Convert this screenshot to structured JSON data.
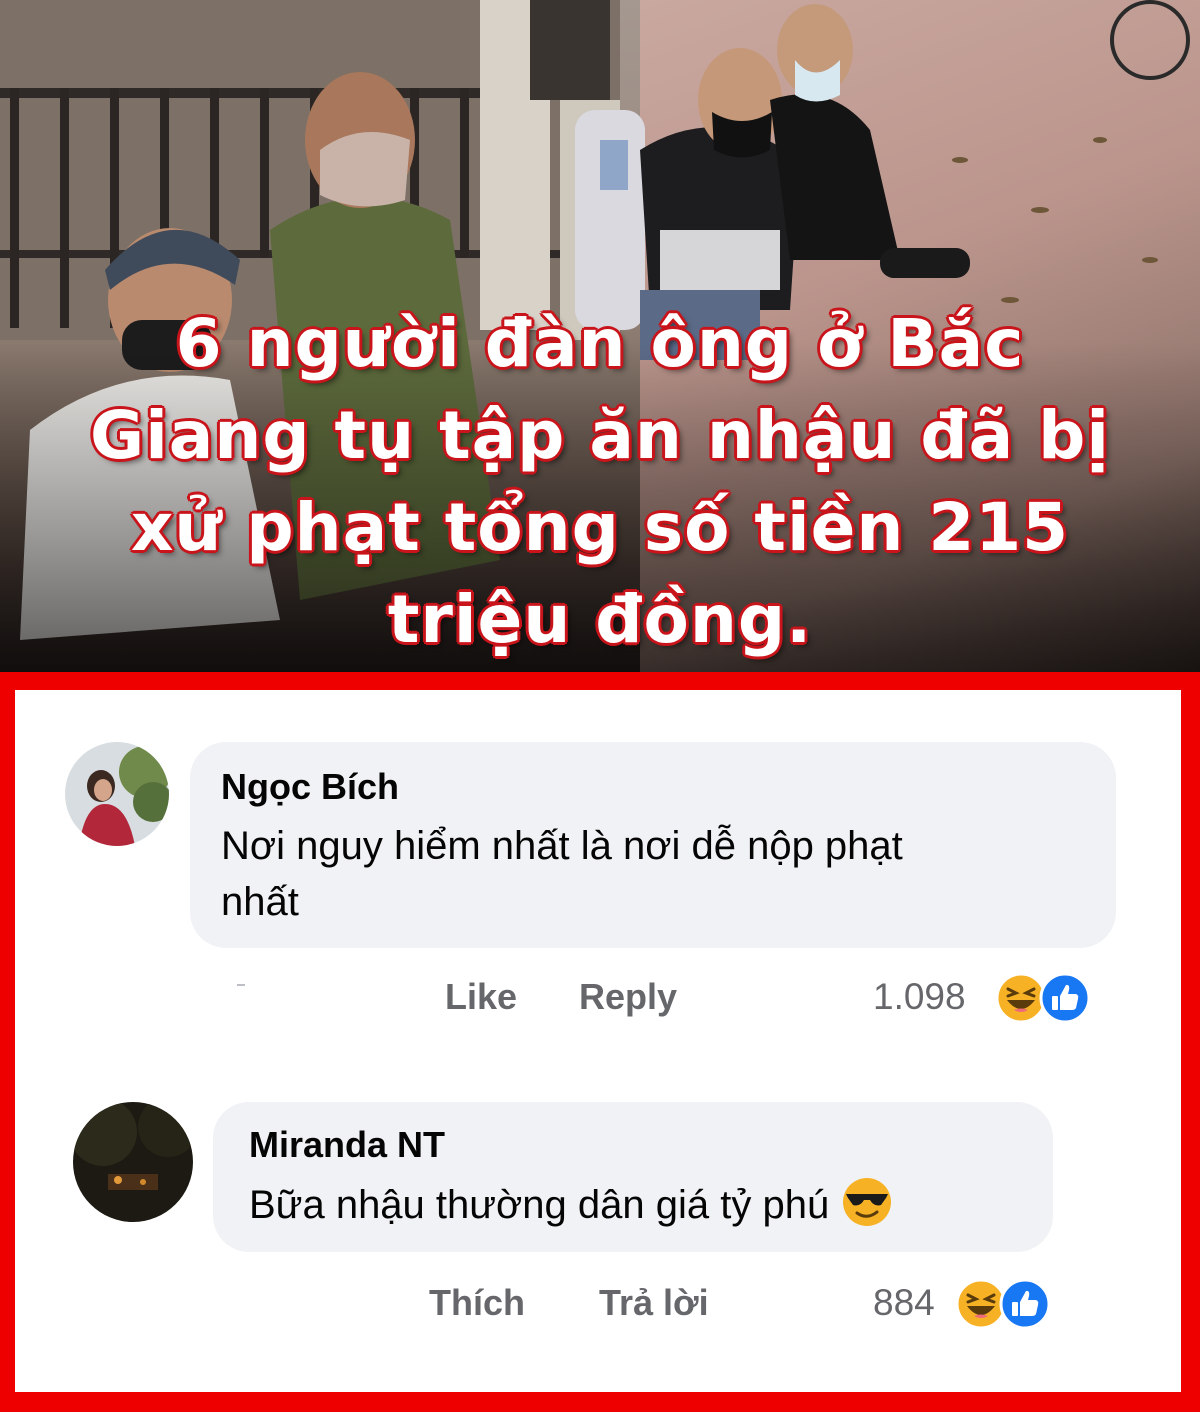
{
  "headline": {
    "lines": [
      "6 người đàn ông ở Bắc",
      "Giang tụ tập ăn nhậu đã bị",
      "xử phạt tổng số tiền 215",
      "triệu đồng."
    ]
  },
  "comments": [
    {
      "author": "Ngọc Bích",
      "text_lines": [
        "Nơi nguy hiểm nhất là nơi dễ nộp phạt",
        "nhất"
      ],
      "like_label": "Like",
      "reply_label": "Reply",
      "reaction_count": "1.098",
      "reactions": [
        "haha-icon",
        "like-icon"
      ]
    },
    {
      "author": "Miranda NT",
      "text": "Bữa nhậu thường dân giá tỷ phú",
      "text_emoji": "sunglasses-emoji-icon",
      "like_label": "Thích",
      "reply_label": "Trả lời",
      "reaction_count": "884",
      "reactions": [
        "haha-icon",
        "like-icon"
      ]
    }
  ],
  "colors": {
    "frame": "#ee0000",
    "headline_outline": "#c8141a",
    "bubble": "#f0f2f5",
    "meta_text": "#65676b",
    "like_blue": "#1877f2",
    "haha_yellow": "#f7b125"
  }
}
